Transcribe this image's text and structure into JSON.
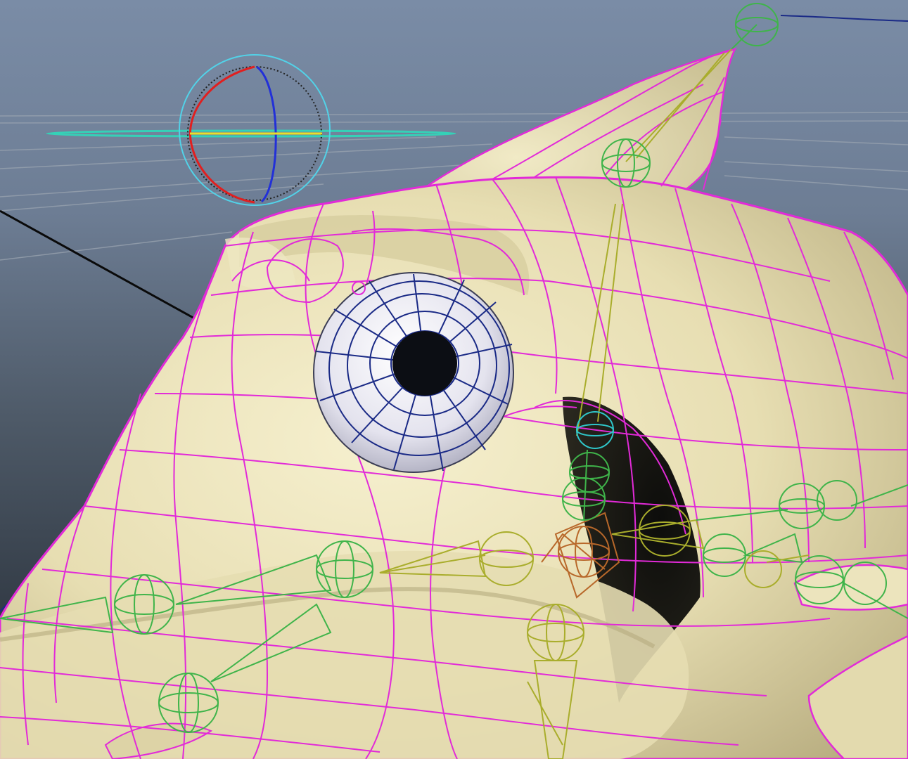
{
  "viewport": {
    "background_top": "#6f829c",
    "background_mid": "#6c7b8e",
    "background_bottom": "#1f252d"
  },
  "colors": {
    "mesh_surface": "#e8e0b6",
    "mesh_shadow": "#a89e72",
    "wireframe": "#e22ad8",
    "joint_green": "#3fb44a",
    "joint_olive": "#a9ad2c",
    "joint_orange": "#b8682a",
    "joint_cyan": "#2fc6c9",
    "eye_wire": "#1a2a86",
    "pupil": "#0c0e14",
    "grid_line": "#9aa4b0",
    "axis_black": "#0a0a0a"
  },
  "icons": [
    "rotate-manipulator-icon",
    "character-mesh",
    "eyeball",
    "skeleton-joint-chain"
  ]
}
